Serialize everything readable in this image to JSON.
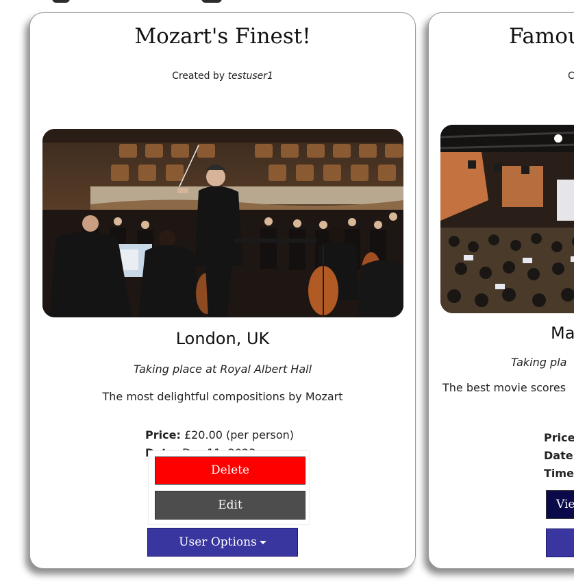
{
  "colors": {
    "delete": "#ff0000",
    "edit": "#4d4d4d",
    "user_options": "#3a36a0",
    "view": "#0a0a4a"
  },
  "cards": [
    {
      "title": "Mozart's Finest!",
      "created_by_prefix": "Created by",
      "created_by_user": "testuser1",
      "location": "London, UK",
      "venue": "Taking place at Royal Albert Hall",
      "description": "The most delightful compositions by Mozart",
      "price_label": "Price:",
      "price_value": "£20.00 (per person)",
      "date_label": "Date:",
      "date_value": "Dec 11, 2023",
      "menu": {
        "delete": "Delete",
        "edit": "Edit",
        "user_options": "User Options"
      }
    },
    {
      "title": "Famou",
      "created_by_prefix": "C",
      "location": "Ma",
      "venue": "Taking pla",
      "description": "The best movie scores",
      "price_label": "Price",
      "date_label": "Date",
      "time_label": "Time",
      "view_button": "Vie"
    }
  ]
}
